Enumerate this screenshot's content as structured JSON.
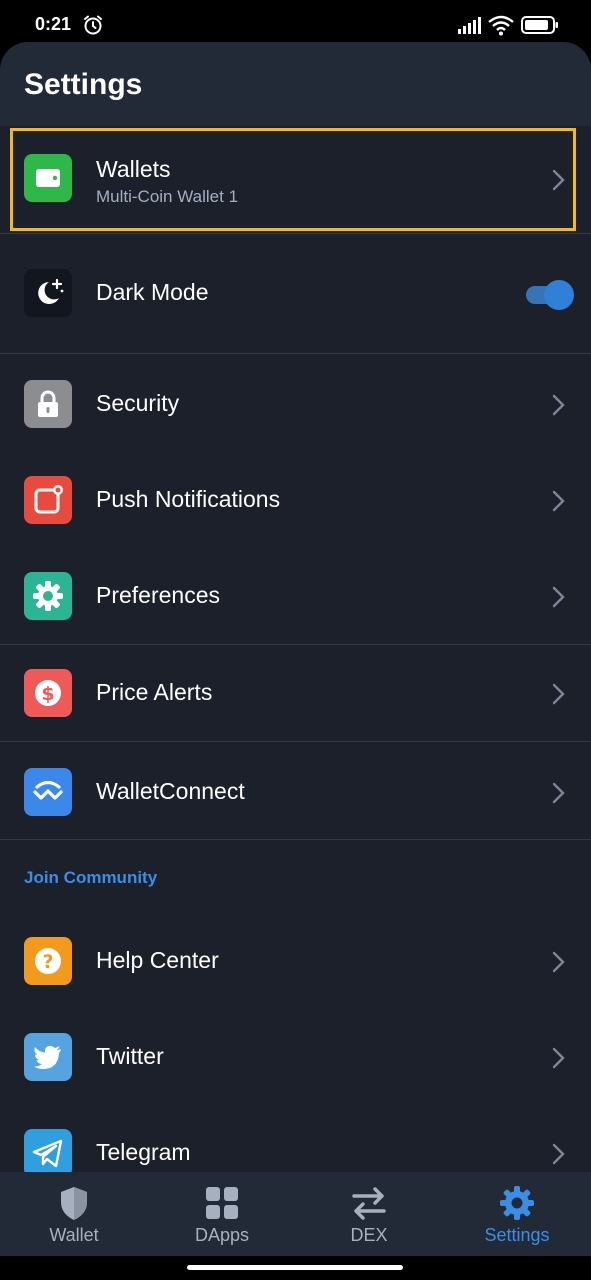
{
  "status_bar": {
    "time": "0:21"
  },
  "header": {
    "title": "Settings"
  },
  "rows": [
    {
      "label": "Wallets",
      "sublabel": "Multi-Coin Wallet 1",
      "icon": "wallet-icon",
      "color": "#2eb84a"
    },
    {
      "label": "Dark Mode",
      "icon": "moon-stars-icon",
      "toggle_on": true
    },
    {
      "label": "Security",
      "icon": "lock-icon",
      "color": "#8c8d91"
    },
    {
      "label": "Push Notifications",
      "icon": "notification-icon",
      "color": "#e94a3e"
    },
    {
      "label": "Preferences",
      "icon": "gear-icon",
      "color": "#2bb595"
    },
    {
      "label": "Price Alerts",
      "icon": "dollar-icon",
      "color": "#ed5a58"
    },
    {
      "label": "WalletConnect",
      "icon": "walletconnect-icon",
      "color": "#3b88ea"
    },
    {
      "label": "Help Center",
      "icon": "question-icon",
      "color": "#f39a1d"
    },
    {
      "label": "Twitter",
      "icon": "twitter-icon",
      "color": "#56a4df"
    },
    {
      "label": "Telegram",
      "icon": "telegram-icon",
      "color": "#2f9fe0"
    }
  ],
  "section": {
    "join_community": "Join Community"
  },
  "bottom_nav": [
    {
      "label": "Wallet",
      "icon": "shield-icon",
      "active": false
    },
    {
      "label": "DApps",
      "icon": "grid-icon",
      "active": false
    },
    {
      "label": "DEX",
      "icon": "swap-arrows-icon",
      "active": false
    },
    {
      "label": "Settings",
      "icon": "gear-icon",
      "active": true
    }
  ],
  "colors": {
    "accent": "#3b8ee6",
    "highlight": "#f5b90f",
    "background": "#1b202b",
    "appbar": "#222a37"
  }
}
